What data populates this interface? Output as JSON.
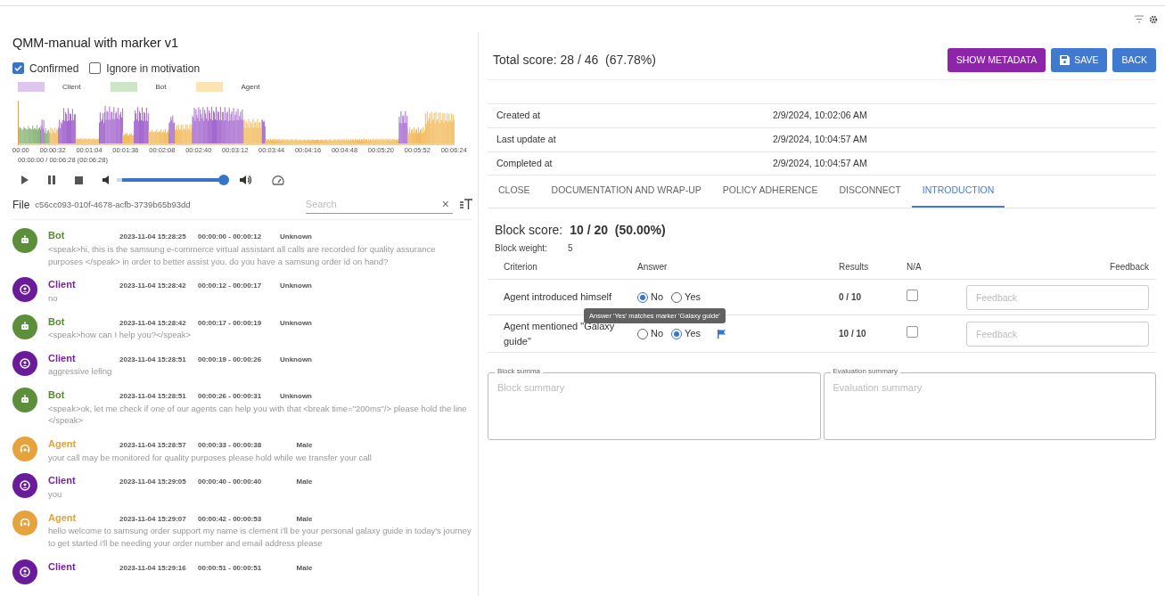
{
  "title": "QMM-manual with marker v1",
  "checkboxes": [
    {
      "label": "Confirmed",
      "checked": true
    },
    {
      "label": "Ignore in motivation",
      "checked": false
    }
  ],
  "legend": [
    {
      "label": "Client",
      "color": "#dcc6ec"
    },
    {
      "label": "Bot",
      "color": "#cfe5c8"
    },
    {
      "label": "Agent",
      "color": "#fbe3b4"
    }
  ],
  "timeline_ticks": [
    "00:00",
    "00:00:32",
    "00:01:04",
    "00:01:36",
    "00:02:08",
    "00:02:40",
    "00:03:12",
    "00:03:44",
    "00:04:16",
    "00:04:48",
    "00:05:20",
    "00:05:52",
    "00:06:24"
  ],
  "position": "00:00:00 / 00:06:28 (00:06:28)",
  "volume": {
    "level": 1
  },
  "file": {
    "label": "File",
    "id": "c56cc093-010f-4678-acfb-3739b65b93dd"
  },
  "search": {
    "placeholder": "Search",
    "clear": "×"
  },
  "messages": [
    {
      "kind": "bot",
      "speaker": "Bot",
      "date": "2023-11-04 15:28:25",
      "span": "00:00:00 - 00:00:12",
      "gender": "Unknown",
      "text": "<speak>hi, this is the samsung e-commerce virtual assistant all calls are recorded for quality assurance purposes </speak> in order to better assist you. do you have a samsung order id on hand?"
    },
    {
      "kind": "client",
      "speaker": "Client",
      "date": "2023-11-04 15:28:42",
      "span": "00:00:12 - 00:00:17",
      "gender": "Unknown",
      "text": "no"
    },
    {
      "kind": "bot",
      "speaker": "Bot",
      "date": "2023-11-04 15:28:42",
      "span": "00:00:17 - 00:00:19",
      "gender": "Unknown",
      "text": "<speak>how can I help you?</speak>"
    },
    {
      "kind": "client",
      "speaker": "Client",
      "date": "2023-11-04 15:28:51",
      "span": "00:00:19 - 00:00:26",
      "gender": "Unknown",
      "text": "aggressive lefing"
    },
    {
      "kind": "bot",
      "speaker": "Bot",
      "date": "2023-11-04 15:28:51",
      "span": "00:00:26 - 00:00:31",
      "gender": "Unknown",
      "text": "<speak>ok, let me check if one of our agents can help you with that <break time=\"200ms\"/> please hold the line </speak>"
    },
    {
      "kind": "agent",
      "speaker": "Agent",
      "date": "2023-11-04 15:28:57",
      "span": "00:00:33 - 00:00:38",
      "gender": "Male",
      "text": "your call may be monitored for quality purposes please hold while we transfer your call"
    },
    {
      "kind": "client",
      "speaker": "Client",
      "date": "2023-11-04 15:29:05",
      "span": "00:00:40 - 00:00:40",
      "gender": "Male",
      "text": "you"
    },
    {
      "kind": "agent",
      "speaker": "Agent",
      "date": "2023-11-04 15:29:07",
      "span": "00:00:42 - 00:00:53",
      "gender": "Male",
      "text": "hello welcome to samsung order support my name is clement i'll be your personal galaxy guide in today's journey to get started i'll be needing your order number and email address please"
    },
    {
      "kind": "client",
      "speaker": "Client",
      "date": "2023-11-04 15:29:16",
      "span": "00:00:51 - 00:00:51",
      "gender": "Male"
    }
  ],
  "total_score": {
    "label": "Total score:",
    "value": "28 / 46",
    "percent": "(67.78%)"
  },
  "buttons": [
    {
      "label": "SHOW METADATA",
      "kind": "metadata"
    },
    {
      "label": "SAVE",
      "kind": "save"
    },
    {
      "label": "BACK",
      "kind": "back"
    }
  ],
  "meta": [
    {
      "label": "Created at",
      "value": "2/9/2024, 10:02:06 AM"
    },
    {
      "label": "Last update at",
      "value": "2/9/2024, 10:04:57 AM"
    },
    {
      "label": "Completed at",
      "value": "2/9/2024, 10:04:57 AM"
    }
  ],
  "tabs": [
    {
      "label": "CLOSE",
      "selected": false
    },
    {
      "label": "DOCUMENTATION AND WRAP-UP",
      "selected": false
    },
    {
      "label": "POLICY ADHERENCE",
      "selected": false
    },
    {
      "label": "DISCONNECT",
      "selected": false
    },
    {
      "label": "INTRODUCTION",
      "selected": true
    }
  ],
  "block": {
    "score_label": "Block score:",
    "score": "10 / 20",
    "percent": "(50.00%)",
    "weight_label": "Block weight:",
    "weight": "5"
  },
  "columns": [
    "Criterion",
    "Answer",
    "Results",
    "N/A",
    "Feedback"
  ],
  "criteria": [
    {
      "name": "Agent introduced himself",
      "options": [
        {
          "label": "No",
          "selected": true
        },
        {
          "label": "Yes",
          "selected": false
        }
      ],
      "flagged": false,
      "result": "0 / 10",
      "na": false,
      "feedback_placeholder": "Feedback"
    },
    {
      "name": "Agent mentioned \"Galaxy guide\"",
      "options": [
        {
          "label": "No",
          "selected": false
        },
        {
          "label": "Yes",
          "selected": true
        }
      ],
      "flagged": true,
      "result": "10 / 10",
      "na": false,
      "feedback_placeholder": "Feedback"
    }
  ],
  "tooltip": "Answer 'Yes' matches marker 'Galaxy guide'",
  "summaries": [
    {
      "label": "Block summa",
      "placeholder": "Block summary"
    },
    {
      "label": "Evaluation summary",
      "placeholder": "Evaluation summary"
    }
  ]
}
